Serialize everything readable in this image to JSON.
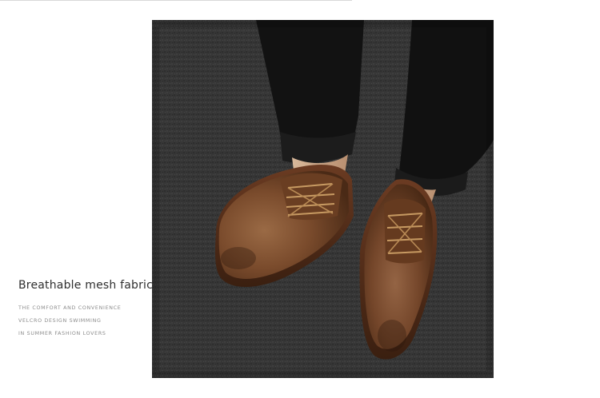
{
  "caption": {
    "title": "Breathable mesh fabric",
    "lines": [
      "THE COMFORT AND CONVENIENCE",
      "VELCRO DESIGN SWIMMING",
      "IN SUMMER FASHION LOVERS"
    ]
  },
  "colors": {
    "carpet": "#3a3a3a",
    "leather": "#7a4a2a",
    "trousers": "#111111",
    "title_text": "#2f2f2f",
    "body_text": "#8c8c8c"
  }
}
